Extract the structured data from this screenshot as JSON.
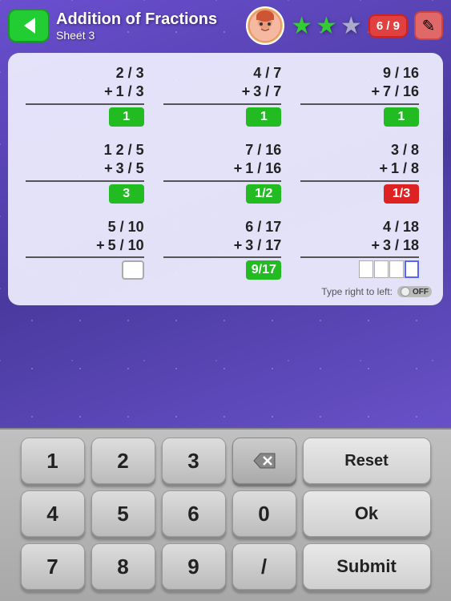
{
  "header": {
    "title": "Addition of Fractions",
    "sheet": "Sheet 3",
    "progress": "6 / 9",
    "back_label": "←",
    "edit_label": "✎"
  },
  "stars": [
    {
      "filled": true,
      "label": "star 1"
    },
    {
      "filled": true,
      "label": "star 2"
    },
    {
      "filled": false,
      "label": "star 3"
    }
  ],
  "problems": [
    {
      "id": "p1",
      "top": "2 / 3",
      "bottom": "1 / 3",
      "answer": "1",
      "answer_state": "correct"
    },
    {
      "id": "p2",
      "top": "4 / 7",
      "bottom": "3 / 7",
      "answer": "1",
      "answer_state": "correct"
    },
    {
      "id": "p3",
      "top": "9 / 16",
      "bottom": "7 / 16",
      "answer": "1",
      "answer_state": "correct"
    },
    {
      "id": "p4",
      "top": "1 2 / 5",
      "bottom": "3 / 5",
      "answer": "3",
      "answer_state": "correct"
    },
    {
      "id": "p5",
      "top": "7 / 16",
      "bottom": "1 / 16",
      "answer": "1/2",
      "answer_state": "correct"
    },
    {
      "id": "p6",
      "top": "3 / 8",
      "bottom": "1 / 8",
      "answer": "1/3",
      "answer_state": "wrong"
    },
    {
      "id": "p7",
      "top": "5 / 10",
      "bottom": "5 / 10",
      "answer": "",
      "answer_state": "empty-single"
    },
    {
      "id": "p8",
      "top": "6 / 17",
      "bottom": "3 / 17",
      "answer": "9/17",
      "answer_state": "correct"
    },
    {
      "id": "p9",
      "top": "4 / 18",
      "bottom": "3 / 18",
      "answer": "",
      "answer_state": "empty-multi"
    }
  ],
  "type_right_label": "Type right to left:",
  "toggle_label": "OFF",
  "keyboard": {
    "rows": [
      [
        "1",
        "2",
        "3",
        "⌫",
        "Reset"
      ],
      [
        "4",
        "5",
        "6",
        "0",
        "Ok"
      ],
      [
        "7",
        "8",
        "9",
        "/",
        "Submit"
      ]
    ]
  }
}
